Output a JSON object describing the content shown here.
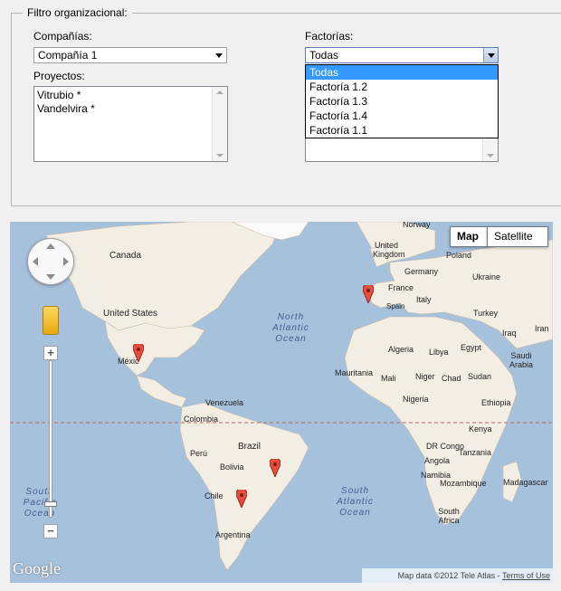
{
  "filter": {
    "legend": "Filtro organizacional:",
    "companies_label": "Compañías:",
    "companies_value": "Compañía 1",
    "projects_label": "Proyectos:",
    "projects": [
      "Vitrubio *",
      "Vandelvira *"
    ],
    "factories_label": "Factorías:",
    "factories_value": "Todas",
    "factories_options": [
      "Todas",
      "Factoría 1.2",
      "Factoría 1.3",
      "Factoría 1.4",
      "Factoría 1.1"
    ]
  },
  "map": {
    "type_buttons": {
      "map": "Map",
      "satellite": "Satellite"
    },
    "labels": {
      "canada": "Canada",
      "usa": "United States",
      "mexico": "Méxic",
      "venezuela": "Venezuela",
      "colombia": "Colombia",
      "brazil": "Brazil",
      "peru": "Perú",
      "bolivia": "Bolivia",
      "chile": "Chile",
      "argentina": "Argentina",
      "norway": "Norway",
      "uk": "United Kingdom",
      "germany": "Germany",
      "poland": "Poland",
      "ukraine": "Ukraine",
      "france": "France",
      "italy": "Italy",
      "spain": "Spain",
      "turkey": "Turkey",
      "algeria": "Algeria",
      "libya": "Libya",
      "egypt": "Egypt",
      "iraq": "Iraq",
      "iran": "Iran",
      "saudi": "Saudi Arabia",
      "mauritania": "Mauritania",
      "mali": "Mali",
      "niger": "Niger",
      "chad": "Chad",
      "sudan": "Sudan",
      "nigeria": "Nigeria",
      "ethiopia": "Ethiopia",
      "drc": "DR Congo",
      "kenya": "Kenya",
      "tanzania": "Tanzania",
      "angola": "Angola",
      "namibia": "Namibia",
      "mozambique": "Mozambique",
      "madagascar": "Madagascar",
      "south_africa": "South Africa"
    },
    "oceans": {
      "north_atlantic": "North Atlantic Ocean",
      "south_atlantic": "South Atlantic Ocean",
      "south_pacific": "South Pacific Ocean"
    },
    "logo": "Google",
    "attribution": "Map data ©2012 Tele Atlas - ",
    "terms": "Terms of Use"
  }
}
